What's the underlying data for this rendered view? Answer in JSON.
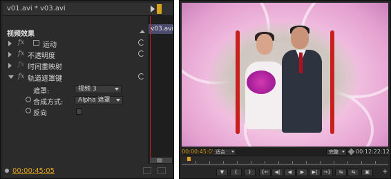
{
  "effect_controls": {
    "header_title": "v01.avi * v03.avi",
    "clip_tab": "v03.avi",
    "section_title": "视频效果",
    "effects": [
      {
        "label": "运动",
        "expanded": false,
        "fx": "fx"
      },
      {
        "label": "不透明度",
        "expanded": false,
        "fx": "fx"
      },
      {
        "label": "时间重映射",
        "expanded": false,
        "fx": "fx"
      },
      {
        "label": "轨道遮罩键",
        "expanded": true,
        "fx": "fx"
      }
    ],
    "props": {
      "matte_label": "遮罩:",
      "matte_value": "视频 3",
      "composite_label": "合成方式:",
      "composite_value": "Alpha 遮罩",
      "reverse_label": "反向",
      "reverse_checked": false
    },
    "footer_time": "00:00:45:05"
  },
  "program_monitor": {
    "current_time": "00:00:45:05",
    "fit_value": "适合",
    "quality_value": "完整",
    "duration": "00:12:22:12",
    "transport_buttons": [
      "▼",
      "{",
      "}",
      "{←",
      "◀|",
      "◀",
      "▶",
      "▶|",
      "→}",
      "⇆",
      "⇆",
      "▣"
    ],
    "plus_label": "+"
  },
  "colors": {
    "accent_time": "#e0a020",
    "playhead": "#c02020",
    "clip": "#4b4b6e"
  }
}
